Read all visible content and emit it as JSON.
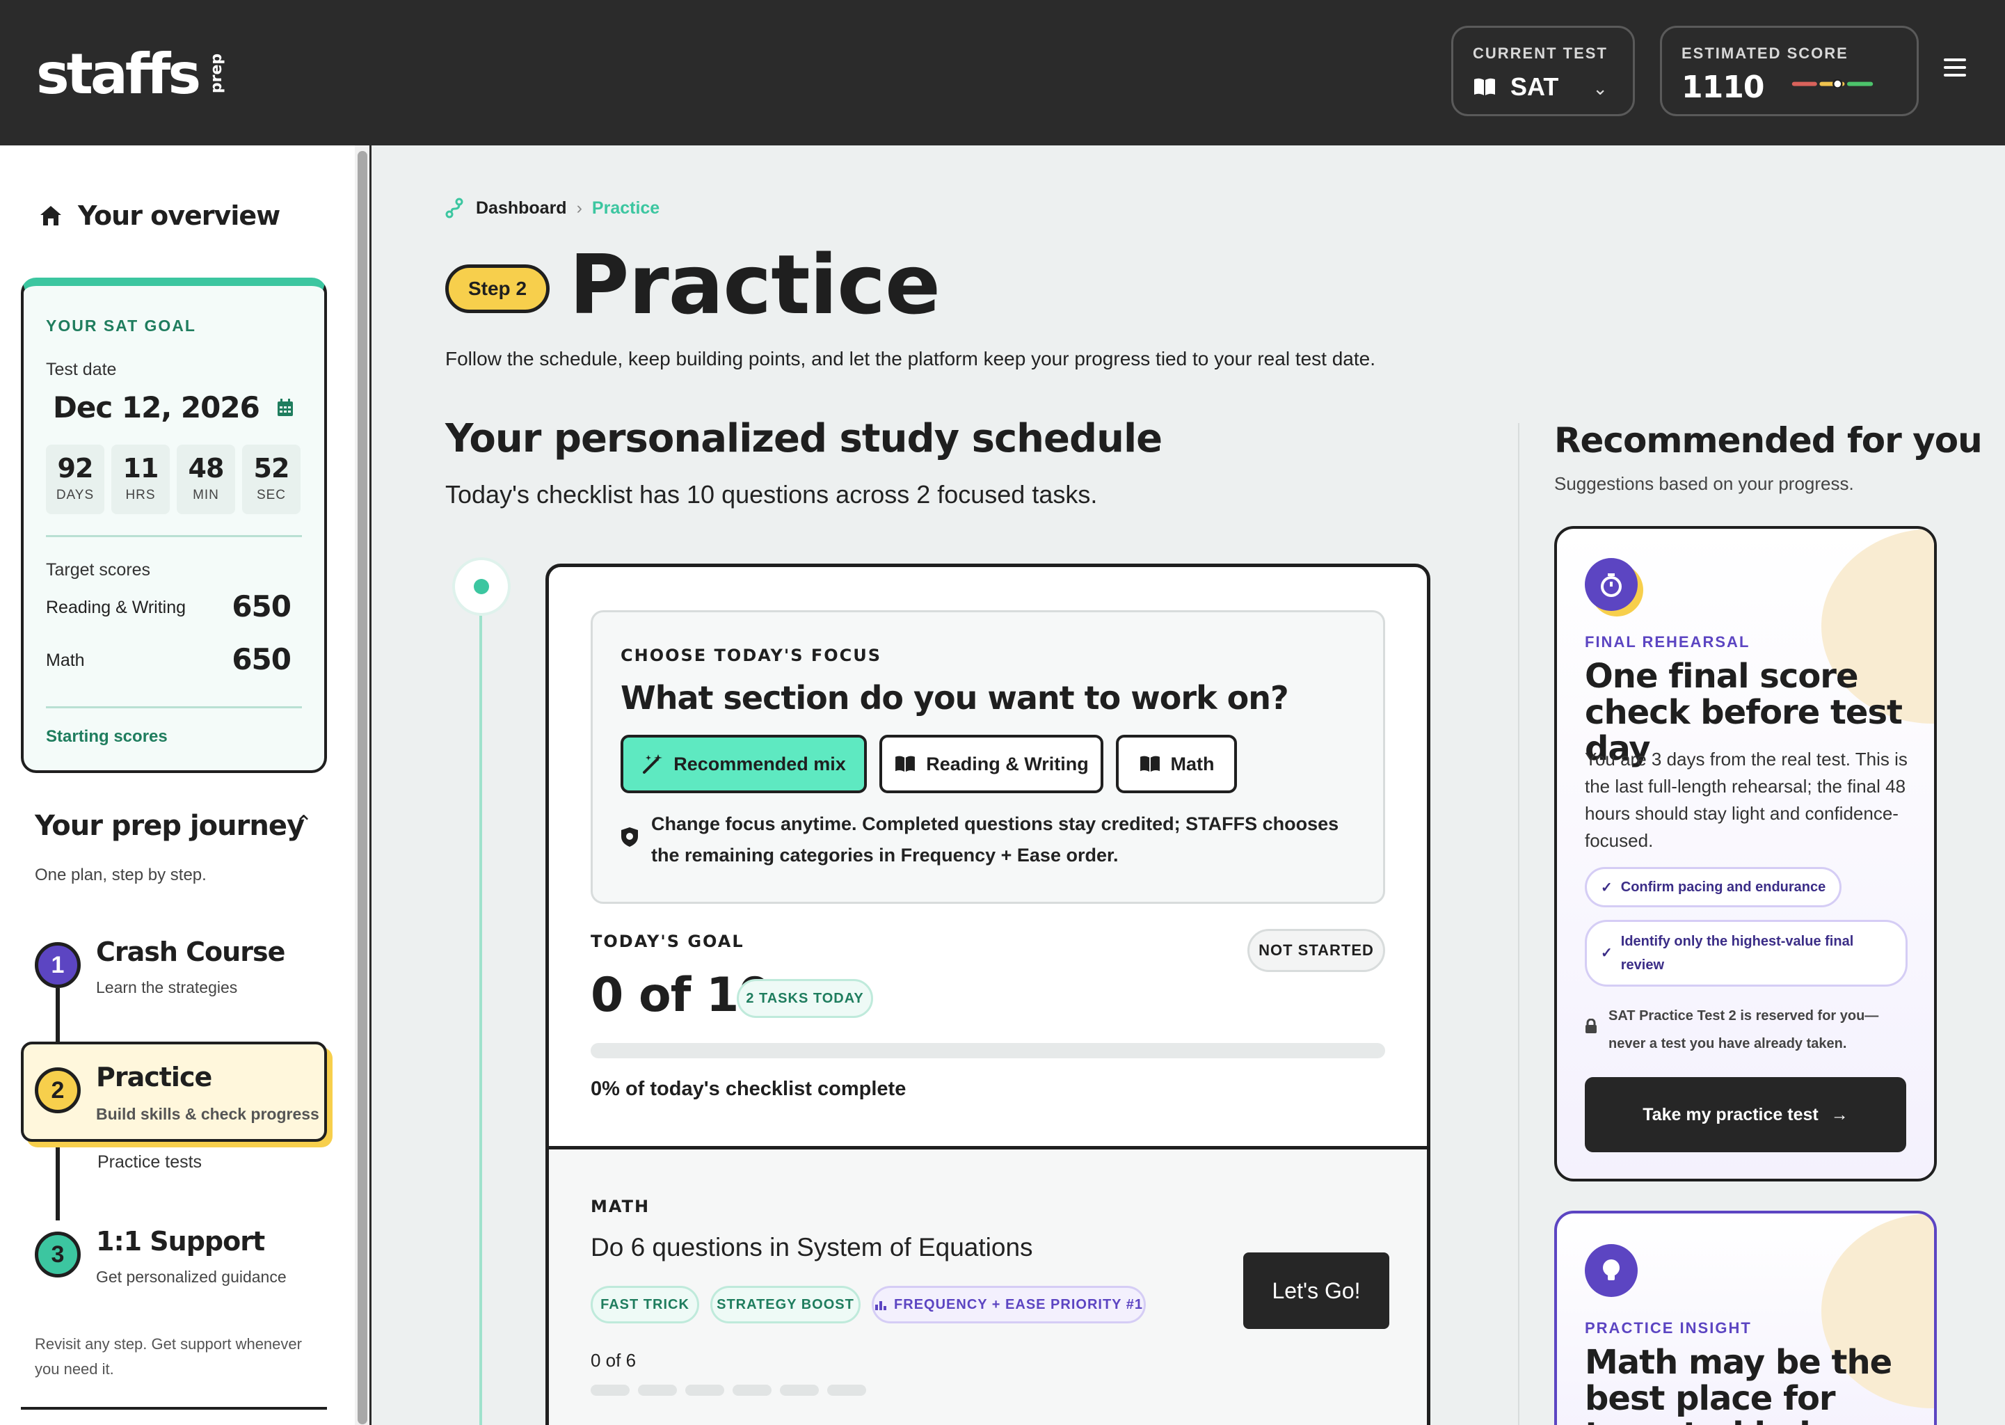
{
  "header": {
    "logo": "staffs",
    "logo_suffix": "prep",
    "current_test_label": "CURRENT TEST",
    "current_test_value": "SAT",
    "estimated_score_label": "ESTIMATED SCORE",
    "estimated_score_value": "1110",
    "estimated_score_level": 0.57
  },
  "sidebar": {
    "overview": "Your overview",
    "goal": {
      "title": "YOUR SAT GOAL",
      "test_date_label": "Test date",
      "test_date": "Dec 12, 2026",
      "countdown": [
        {
          "value": "92",
          "unit": "DAYS"
        },
        {
          "value": "11",
          "unit": "HRS"
        },
        {
          "value": "48",
          "unit": "MIN"
        },
        {
          "value": "52",
          "unit": "SEC"
        }
      ],
      "target_label": "Target scores",
      "rw_label": "Reading & Writing",
      "rw_value": "650",
      "math_label": "Math",
      "math_value": "650",
      "starting_link": "Starting scores"
    },
    "journey": {
      "title": "Your prep journey",
      "subtitle": "One plan, step by step.",
      "steps": [
        {
          "num": "1",
          "title": "Crash Course",
          "sub": "Learn the strategies"
        },
        {
          "num": "2",
          "title": "Practice",
          "sub": "Build skills & check progress"
        },
        {
          "num": "3",
          "title": "1:1 Support",
          "sub": "Get personalized guidance"
        }
      ],
      "practice_tests": "Practice tests",
      "revisit": "Revisit any step. Get support whenever you need it."
    }
  },
  "main": {
    "breadcrumb": {
      "root": "Dashboard",
      "current": "Practice"
    },
    "step_pill": "Step 2",
    "title": "Practice",
    "description": "Follow the schedule, keep building points, and let the platform keep your progress tied to your real test date.",
    "schedule_title": "Your personalized study schedule",
    "schedule_sub": "Today's checklist has 10 questions across 2 focused tasks.",
    "focus": {
      "label": "CHOOSE TODAY'S FOCUS",
      "question": "What section do you want to work on?",
      "options": [
        "Recommended mix",
        "Reading & Writing",
        "Math"
      ],
      "note": "Change focus anytime. Completed questions stay credited; STAFFS chooses the remaining categories in Frequency + Ease order."
    },
    "goal": {
      "label": "TODAY'S GOAL",
      "status": "NOT STARTED",
      "value": "0 of 10",
      "tasks_badge": "2 TASKS TODAY",
      "progress": 0,
      "progress_text": "0% of today's checklist complete"
    },
    "task": {
      "label": "MATH",
      "title": "Do 6 questions in System of Equations",
      "chips": [
        "FAST TRICK",
        "STRATEGY BOOST",
        "FREQUENCY + EASE PRIORITY #1"
      ],
      "count": "0 of 6",
      "button": "Let's Go!"
    }
  },
  "recommended": {
    "title": "Recommended for you",
    "subtitle": "Suggestions based on your progress.",
    "card1": {
      "kicker": "FINAL REHEARSAL",
      "headline": "One final score check before test day",
      "body": "You are 3 days from the real test. This is the last full-length rehearsal; the final 48 hours should stay light and confidence-focused.",
      "pill1": "Confirm pacing and endurance",
      "pill2": "Identify only the highest-value final review",
      "note": "SAT Practice Test 2 is reserved for you—never a test you have already taken.",
      "button": "Take my practice test"
    },
    "card2": {
      "kicker": "PRACTICE INSIGHT",
      "headline": "Math may be the best place for targeted help"
    }
  }
}
